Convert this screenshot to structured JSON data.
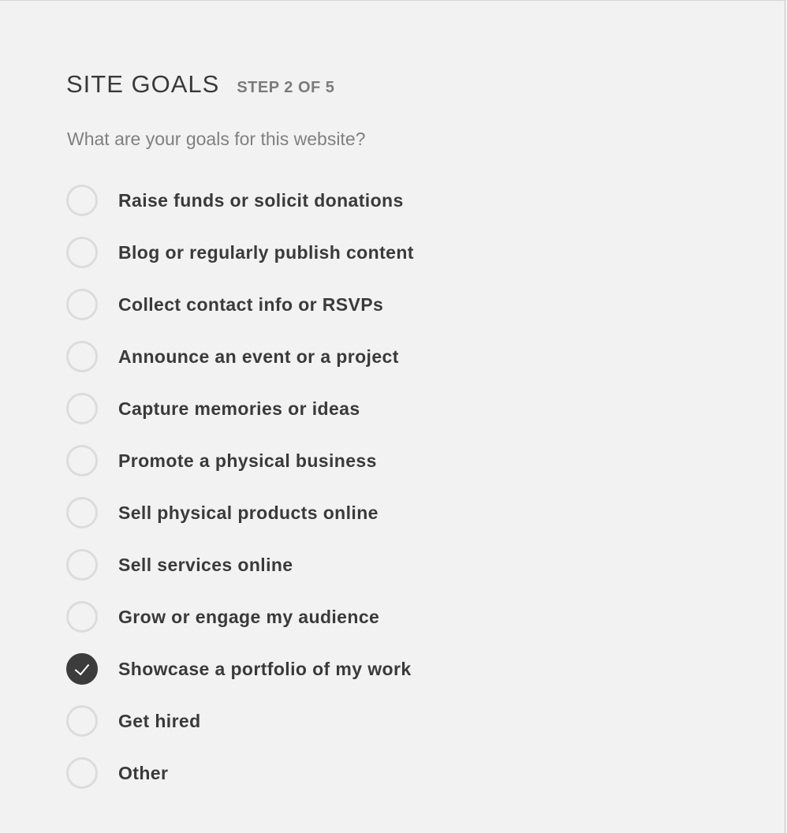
{
  "wizard": {
    "title": "SITE GOALS",
    "step": "STEP 2 OF 5",
    "question": "What are your goals for this website?"
  },
  "options": [
    {
      "label": "Raise funds or solicit donations",
      "checked": false
    },
    {
      "label": "Blog or regularly publish content",
      "checked": false
    },
    {
      "label": "Collect contact info or RSVPs",
      "checked": false
    },
    {
      "label": "Announce an event or a project",
      "checked": false
    },
    {
      "label": "Capture memories or ideas",
      "checked": false
    },
    {
      "label": "Promote a physical business",
      "checked": false
    },
    {
      "label": "Sell physical products online",
      "checked": false
    },
    {
      "label": "Sell services online",
      "checked": false
    },
    {
      "label": "Grow or engage my audience",
      "checked": false
    },
    {
      "label": "Showcase a portfolio of my work",
      "checked": true
    },
    {
      "label": "Get hired",
      "checked": false
    },
    {
      "label": "Other",
      "checked": false
    }
  ],
  "icons": {
    "checked": "checkmark-icon",
    "unchecked": "empty-circle-icon"
  },
  "colors": {
    "background": "#f2f2f2",
    "text_primary": "#3a3a3a",
    "text_secondary": "#7b7b7b",
    "radio_border": "#dcdcdc",
    "radio_checked": "#3c3c3c"
  }
}
